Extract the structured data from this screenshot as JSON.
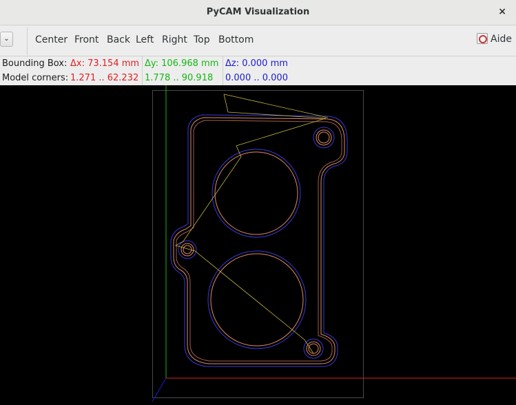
{
  "window": {
    "title": "PyCAM Visualization",
    "close_icon": "×"
  },
  "toolbar": {
    "dropdown_icon": "⌄",
    "views": [
      "Center",
      "Front",
      "Back",
      "Left",
      "Right",
      "Top",
      "Bottom"
    ],
    "help_label": "Aide"
  },
  "info": {
    "bbox_label": "Bounding Box:",
    "dx": "Δx: 73.154 mm",
    "dy": "Δy: 106.968 mm",
    "dz": "Δz: 0.000 mm",
    "corners_label": "Model corners:",
    "x_range": "1.271 .. 62.232",
    "y_range": "1.778 .. 90.918",
    "z_range": "0.000 .. 0.000"
  },
  "colors": {
    "x_axis": "#e02020",
    "y_axis": "#12b812",
    "z_axis": "#1a1ad6",
    "model": "#e08a6a",
    "toolpath_blue": "#3a3ad8",
    "move_line": "#c8b640"
  }
}
